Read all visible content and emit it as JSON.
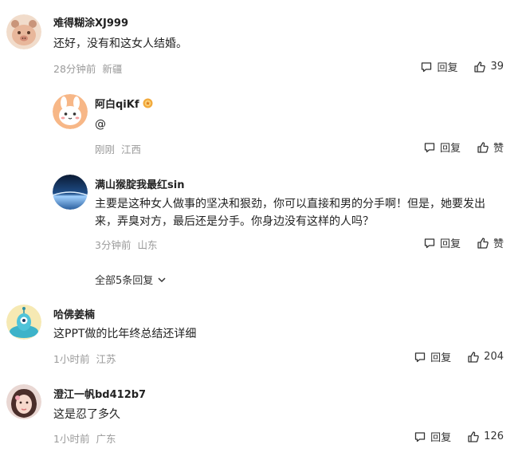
{
  "comments": [
    {
      "username": "难得糊涂XJ999",
      "text": "还好，没有和这女人结婚。",
      "time": "28分钟前",
      "location": "新疆",
      "reply_label": "回复",
      "like_label": "39",
      "avatar_icon": "bear-face"
    },
    {
      "username": "阿白qiKf",
      "badge_icon": "medal-badge",
      "text": "@",
      "time": "刚刚",
      "location": "江西",
      "reply_label": "回复",
      "like_label": "赞",
      "avatar_icon": "bunny-face"
    },
    {
      "username": "满山猴腚我最红sin",
      "text": "主要是这种女人做事的坚决和狠劲，你可以直接和男的分手啊！但是，她要发出来，弄臭对方，最后还是分手。你身边没有这样的人吗？",
      "time": "3分钟前",
      "location": "山东",
      "reply_label": "回复",
      "like_label": "赞",
      "avatar_icon": "earth-horizon"
    },
    {
      "username": "哈佛姜楠",
      "text": "这PPT做的比年终总结还详细",
      "time": "1小时前",
      "location": "江苏",
      "reply_label": "回复",
      "like_label": "204",
      "avatar_icon": "alien-cartoon"
    },
    {
      "username": "澄江一帆bd412b7",
      "text": "这是忍了多久",
      "time": "1小时前",
      "location": "广东",
      "reply_label": "回复",
      "like_label": "126",
      "avatar_icon": "girl-photo"
    }
  ],
  "expand_replies_label": "全部5条回复",
  "colors": {
    "meta": "#9a9a9a",
    "text": "#222222",
    "background": "#ffffff"
  }
}
